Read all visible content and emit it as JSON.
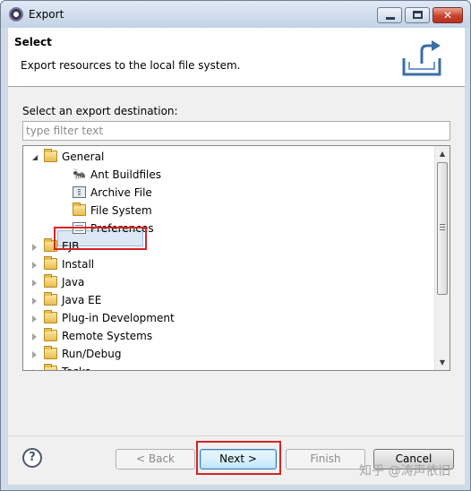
{
  "window": {
    "title": "Export",
    "controls": {
      "minimize_glyph": "",
      "maximize_glyph": "",
      "close_glyph": "✕"
    }
  },
  "header": {
    "title": "Select",
    "description": "Export resources to the local file system.",
    "icon": "export-wizard-icon"
  },
  "main": {
    "section_label": "Select an export destination:",
    "filter_placeholder": "type filter text",
    "filter_value": "",
    "tree": [
      {
        "label": "General",
        "depth": 0,
        "state": "expanded",
        "icon": "folder-icon"
      },
      {
        "label": "Ant Buildfiles",
        "depth": 1,
        "state": "leaf",
        "icon": "ant-icon"
      },
      {
        "label": "Archive File",
        "depth": 1,
        "state": "leaf",
        "icon": "archive-icon"
      },
      {
        "label": "File System",
        "depth": 1,
        "state": "leaf",
        "icon": "folder-icon",
        "selected": true
      },
      {
        "label": "Preferences",
        "depth": 1,
        "state": "leaf",
        "icon": "preferences-icon"
      },
      {
        "label": "EJB",
        "depth": 0,
        "state": "collapsed",
        "icon": "folder-icon"
      },
      {
        "label": "Install",
        "depth": 0,
        "state": "collapsed",
        "icon": "folder-icon"
      },
      {
        "label": "Java",
        "depth": 0,
        "state": "collapsed",
        "icon": "folder-icon"
      },
      {
        "label": "Java EE",
        "depth": 0,
        "state": "collapsed",
        "icon": "folder-icon"
      },
      {
        "label": "Plug-in Development",
        "depth": 0,
        "state": "collapsed",
        "icon": "folder-icon"
      },
      {
        "label": "Remote Systems",
        "depth": 0,
        "state": "collapsed",
        "icon": "folder-icon"
      },
      {
        "label": "Run/Debug",
        "depth": 0,
        "state": "collapsed",
        "icon": "folder-icon"
      },
      {
        "label": "Tasks",
        "depth": 0,
        "state": "collapsed",
        "icon": "folder-icon"
      }
    ],
    "scrollbar": {
      "up_glyph": "▲",
      "down_glyph": "▼"
    }
  },
  "footer": {
    "help_glyph": "?",
    "back_label": "< Back",
    "next_label": "Next >",
    "finish_label": "Finish",
    "cancel_label": "Cancel",
    "watermark": "知乎 @涛声依旧"
  }
}
